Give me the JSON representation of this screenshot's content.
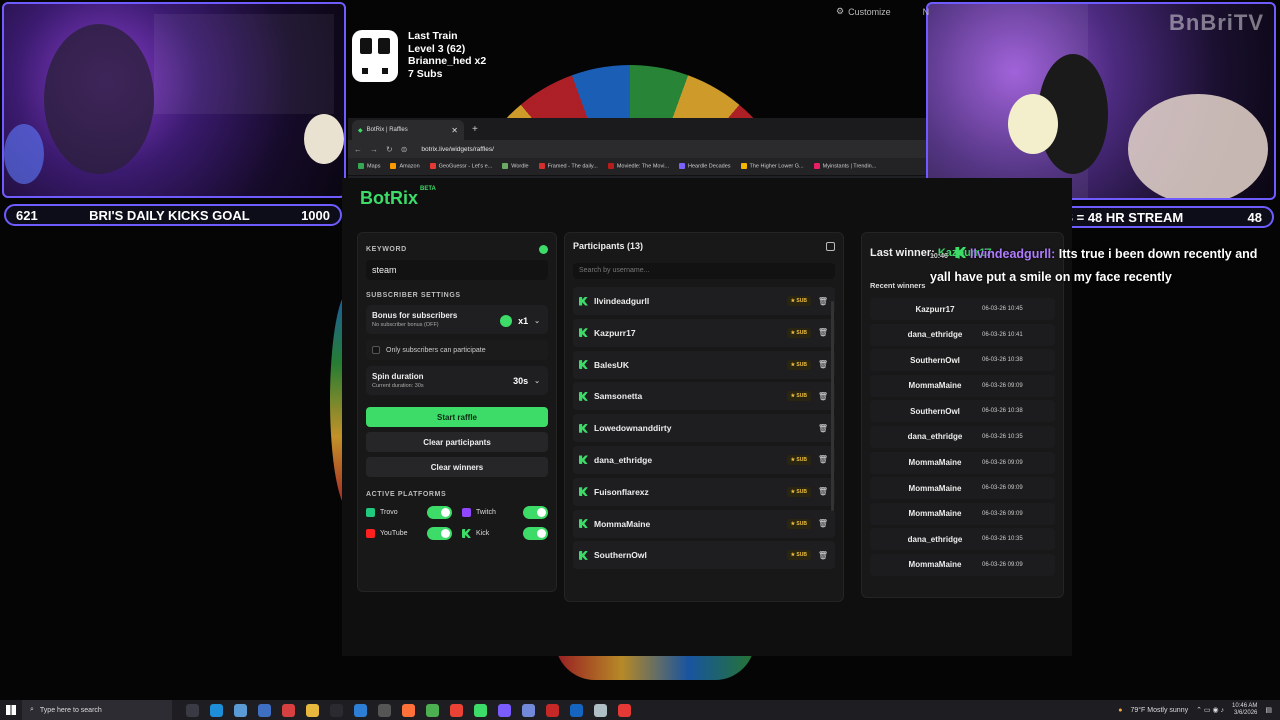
{
  "cams": {
    "left_goal": {
      "current": "621",
      "title": "BRI'S DAILY KICKS GOAL",
      "target": "1000"
    },
    "right_goal": {
      "left": "48",
      "title": "48 SUBS = 48 HR STREAM",
      "right": "48"
    },
    "watermark": "BnBriTV"
  },
  "train": {
    "title": "Last Train",
    "level": "Level 3  (62)",
    "user": "Brianne_hed x2",
    "subs": "7 Subs"
  },
  "topbar": {
    "customize": "Customize",
    "extra": "N"
  },
  "browser": {
    "tab_title": "BotRix | Raffles",
    "url": "botrix.live/widgets/raffles/",
    "bookmarks": [
      "Maps",
      "Amazon",
      "GeoGuessr - Let's e...",
      "Wordle",
      "Framed - The daily...",
      "Moviedle: The Movi...",
      "Heardle Decades",
      "The Higher Lower G...",
      "Myinstants | Trendin..."
    ]
  },
  "app": {
    "logo": "BotRix",
    "beta": "BETA",
    "settings": {
      "keyword_label": "KEYWORD",
      "keyword_value": "steam",
      "subscriber_settings": "SUBSCRIBER SETTINGS",
      "bonus_title": "Bonus for subscribers",
      "bonus_sub": "No subscriber bonus (OFF)",
      "bonus_value": "x1",
      "only_subs": "Only subscribers can participate",
      "spin_title": "Spin duration",
      "spin_sub": "Current duration: 30s",
      "spin_value": "30s",
      "start_raffle": "Start raffle",
      "clear_participants": "Clear participants",
      "clear_winners": "Clear winners",
      "active_platforms": "ACTIVE PLATFORMS",
      "platforms": [
        {
          "name": "Trovo",
          "color": "#1fca7f"
        },
        {
          "name": "Twitch",
          "color": "#9146ff"
        },
        {
          "name": "YouTube",
          "color": "#ff2020"
        },
        {
          "name": "Kick",
          "color": "#3ddc69"
        }
      ]
    },
    "participants": {
      "title": "Participants (13)",
      "search_placeholder": "Search by username...",
      "sub_label": "SUB",
      "rows": [
        {
          "name": "llvindeadgurll",
          "sub": true
        },
        {
          "name": "Kazpurr17",
          "sub": true
        },
        {
          "name": "BalesUK",
          "sub": true
        },
        {
          "name": "Samsonetta",
          "sub": true
        },
        {
          "name": "Lowedownanddirty",
          "sub": false
        },
        {
          "name": "dana_ethridge",
          "sub": true
        },
        {
          "name": "Fuisonflarexz",
          "sub": true
        },
        {
          "name": "MommaMaine",
          "sub": true
        },
        {
          "name": "SouthernOwl",
          "sub": true
        }
      ]
    },
    "winners": {
      "last_winner_label": "Last winner:",
      "last_winner": "Kazpurr17",
      "recent_title": "Recent winners",
      "rows": [
        {
          "name": "Kazpurr17",
          "date": "06-03-26 10:45"
        },
        {
          "name": "dana_ethridge",
          "date": "06-03-26 10:41"
        },
        {
          "name": "SouthernOwl",
          "date": "06-03-26 10:38"
        },
        {
          "name": "MommaMaine",
          "date": "06-03-26 09:09"
        },
        {
          "name": "SouthernOwl",
          "date": "06-03-26 10:38"
        },
        {
          "name": "dana_ethridge",
          "date": "06-03-26 10:35"
        },
        {
          "name": "MommaMaine",
          "date": "06-03-26 09:09"
        },
        {
          "name": "MommaMaine",
          "date": "06-03-26 09:09"
        },
        {
          "name": "MommaMaine",
          "date": "06-03-26 09:09"
        },
        {
          "name": "dana_ethridge",
          "date": "06-03-26 10:35"
        },
        {
          "name": "MommaMaine",
          "date": "06-03-26 09:09"
        }
      ]
    }
  },
  "chat": {
    "time": "10:46",
    "user": "llvindeadgurll:",
    "message": "Itts true i been down recently and yall have put a smile on my face recently"
  },
  "taskbar": {
    "search_placeholder": "Type here to search",
    "weather": "79°F  Mostly sunny",
    "time": "10:46 AM",
    "date": "3/6/2026"
  }
}
